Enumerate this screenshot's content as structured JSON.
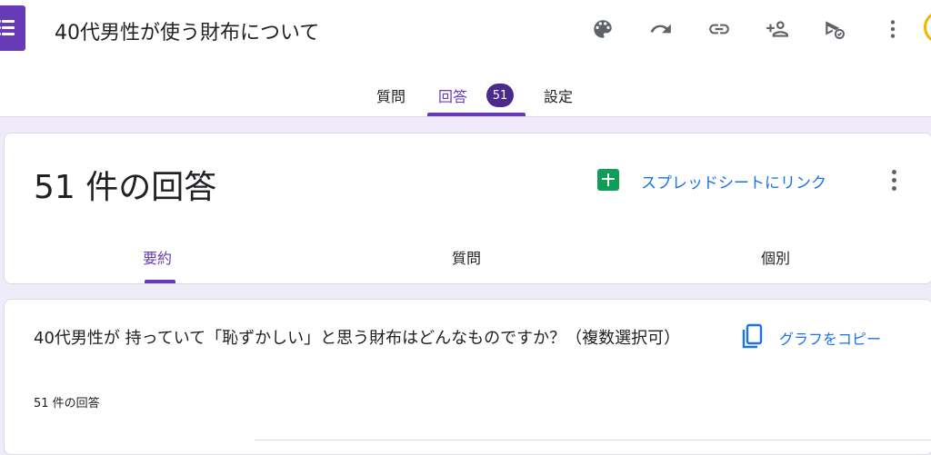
{
  "header": {
    "title": "40代男性が使う財布について",
    "icons": [
      "palette-icon",
      "undo-icon",
      "link-icon",
      "add-collaborator-icon",
      "publish-icon",
      "more-vert-icon"
    ]
  },
  "tabs": [
    {
      "label": "質問"
    },
    {
      "label": "回答",
      "badge": "51",
      "active": true
    },
    {
      "label": "設定"
    }
  ],
  "responses": {
    "count_title": "51 件の回答",
    "sheets_link": "スプレッドシートにリンク",
    "subtabs": [
      {
        "label": "要約",
        "active": true
      },
      {
        "label": "質問"
      },
      {
        "label": "個別"
      }
    ]
  },
  "question": {
    "title": "40代男性が 持っていて「恥ずかしい」と思う財布はどんなものですか？（複数選択可）",
    "response_count": "51 件の回答",
    "copy_chart": "グラフをコピー"
  },
  "colors": {
    "accent": "#673ab7",
    "link": "#1a73e8",
    "sheets": "#0f9d58",
    "background": "#f0ebf8"
  }
}
